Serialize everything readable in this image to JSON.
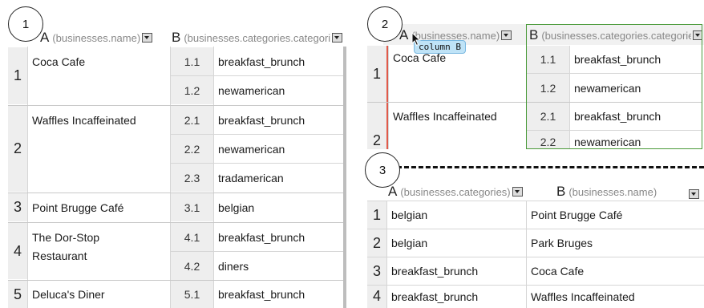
{
  "markers": [
    "1",
    "2",
    "3"
  ],
  "panel1": {
    "col_a_letter": "A",
    "col_a_name": "(businesses.name)",
    "col_b_letter": "B",
    "col_b_name": "(businesses.categories.categories)",
    "groups": [
      {
        "num": "1",
        "name": "Coca Cafe",
        "items": [
          {
            "idx": "1.1",
            "val": "breakfast_brunch"
          },
          {
            "idx": "1.2",
            "val": "newamerican"
          }
        ]
      },
      {
        "num": "2",
        "name": "Waffles Incaffeinated",
        "items": [
          {
            "idx": "2.1",
            "val": "breakfast_brunch"
          },
          {
            "idx": "2.2",
            "val": "newamerican"
          },
          {
            "idx": "2.3",
            "val": "tradamerican"
          }
        ]
      },
      {
        "num": "3",
        "name": "Point Brugge Café",
        "items": [
          {
            "idx": "3.1",
            "val": "belgian"
          }
        ]
      },
      {
        "num": "4",
        "name": "The Dor-Stop Restaurant",
        "items": [
          {
            "idx": "4.1",
            "val": "breakfast_brunch"
          },
          {
            "idx": "4.2",
            "val": "diners"
          }
        ]
      },
      {
        "num": "5",
        "name": "Deluca's Diner",
        "items": [
          {
            "idx": "5.1",
            "val": "breakfast_brunch"
          }
        ]
      }
    ]
  },
  "panel2": {
    "col_a_letter": "A",
    "col_a_name": "(businesses.name)",
    "col_b_letter": "B",
    "col_b_name": "(businesses.categories.categories)",
    "tooltip": "column B",
    "groups": [
      {
        "num": "1",
        "name": "Coca Cafe",
        "items": [
          {
            "idx": "1.1",
            "val": "breakfast_brunch"
          },
          {
            "idx": "1.2",
            "val": "newamerican"
          }
        ]
      },
      {
        "num": "2",
        "name": "Waffles Incaffeinated",
        "items": [
          {
            "idx": "2.1",
            "val": "breakfast_brunch"
          },
          {
            "idx": "2.2",
            "val": "newamerican"
          }
        ]
      }
    ]
  },
  "panel3": {
    "col_a_letter": "A",
    "col_a_name": "(businesses.categories)",
    "col_b_letter": "B",
    "col_b_name": "(businesses.name)",
    "rows": [
      {
        "num": "1",
        "a": "belgian",
        "b": "Point Brugge Café"
      },
      {
        "num": "2",
        "a": "belgian",
        "b": "Park Bruges"
      },
      {
        "num": "3",
        "a": "breakfast_brunch",
        "b": "Coca Cafe"
      },
      {
        "num": "4",
        "a": "breakfast_brunch",
        "b": "Waffles Incaffeinated"
      }
    ]
  }
}
